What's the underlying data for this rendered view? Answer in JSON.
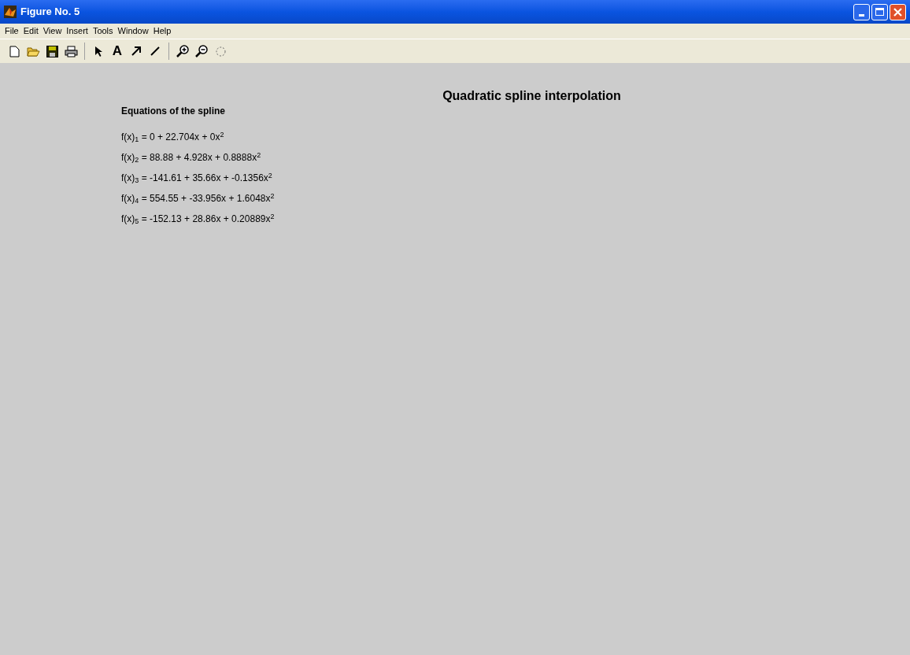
{
  "window": {
    "title": "Figure No. 5"
  },
  "menu": [
    "File",
    "Edit",
    "View",
    "Insert",
    "Tools",
    "Window",
    "Help"
  ],
  "toolbar": {
    "text_tool": "A"
  },
  "figure": {
    "title": "Quadratic spline interpolation",
    "heading": "Equations of the spline",
    "equations": [
      "f(x)$_{1}$ = 0 + 22.704x + 0x$^{2}$",
      "f(x)$_{2}$ = 88.88 + 4.928x + 0.8888x$^{2}$",
      "f(x)$_{3}$ = -141.61 + 35.66x + -0.1356x$^{2}$",
      "f(x)$_{4}$ = 554.55 + -33.956x + 1.6048x$^{2}$",
      "f(x)$_{5}$ = -152.13 + 28.86x + 0.20889x$^{2}$"
    ]
  }
}
